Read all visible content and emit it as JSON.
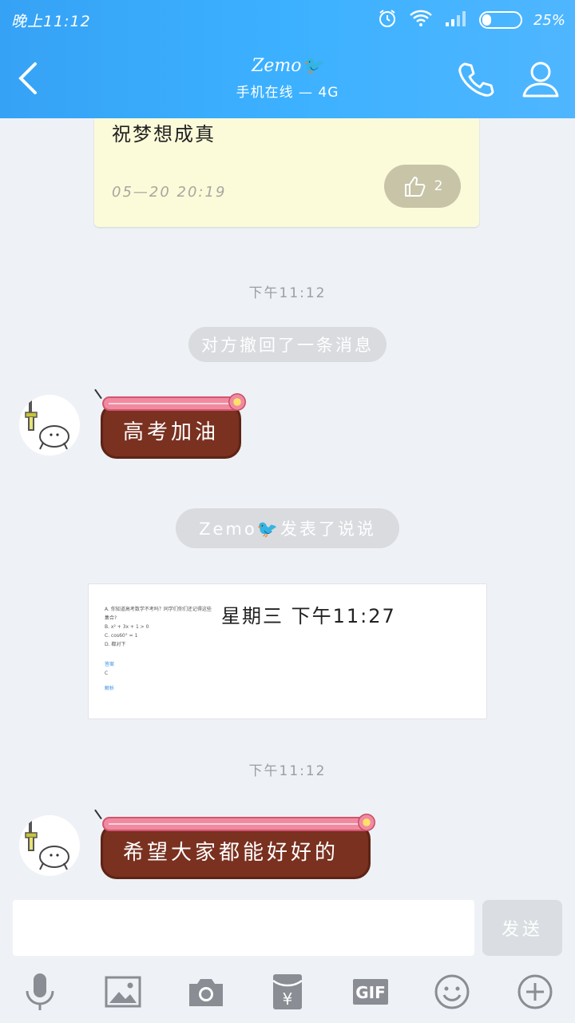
{
  "status_bar": {
    "time": "晚上11:12",
    "battery": "25%",
    "battery_level": 0.25
  },
  "header": {
    "contact_name": "Zemo🐦",
    "contact_status": "手机在线 — 4G"
  },
  "note": {
    "text": "祝梦想成真",
    "time": "05—20  20:19",
    "like_count": "2"
  },
  "timestamps": {
    "first": "下午11:12",
    "second": "下午11:12"
  },
  "system": {
    "recall": "对方撤回了一条消息",
    "share": "Zemo🐦发表了说说"
  },
  "messages": [
    {
      "text": "高考加油"
    },
    {
      "text": "希望大家都能好好的"
    }
  ],
  "share_card": {
    "date": "星期三  下午11:27",
    "thumb_lines": [
      "A. 你知道高考数学不考吗？同学们你们还记得这些",
      "   集合?",
      "B. x² + 3x + 1 > 0",
      "C. cos60° = 1",
      "D. 都对下"
    ],
    "thumb_answer_label": "答案",
    "thumb_answer": "C",
    "thumb_footer": "解析"
  },
  "input": {
    "send_label": "发送"
  },
  "toolbar": [
    "mic-icon",
    "image-icon",
    "camera-icon",
    "red-packet-icon",
    "gif-icon",
    "emoji-icon",
    "plus-icon"
  ],
  "colors": {
    "header": "#3cb1ff",
    "background": "#eef1f6",
    "bubble": "#7a3120",
    "bubble_trim": "#f08aa0",
    "note": "#fcfbd9"
  }
}
